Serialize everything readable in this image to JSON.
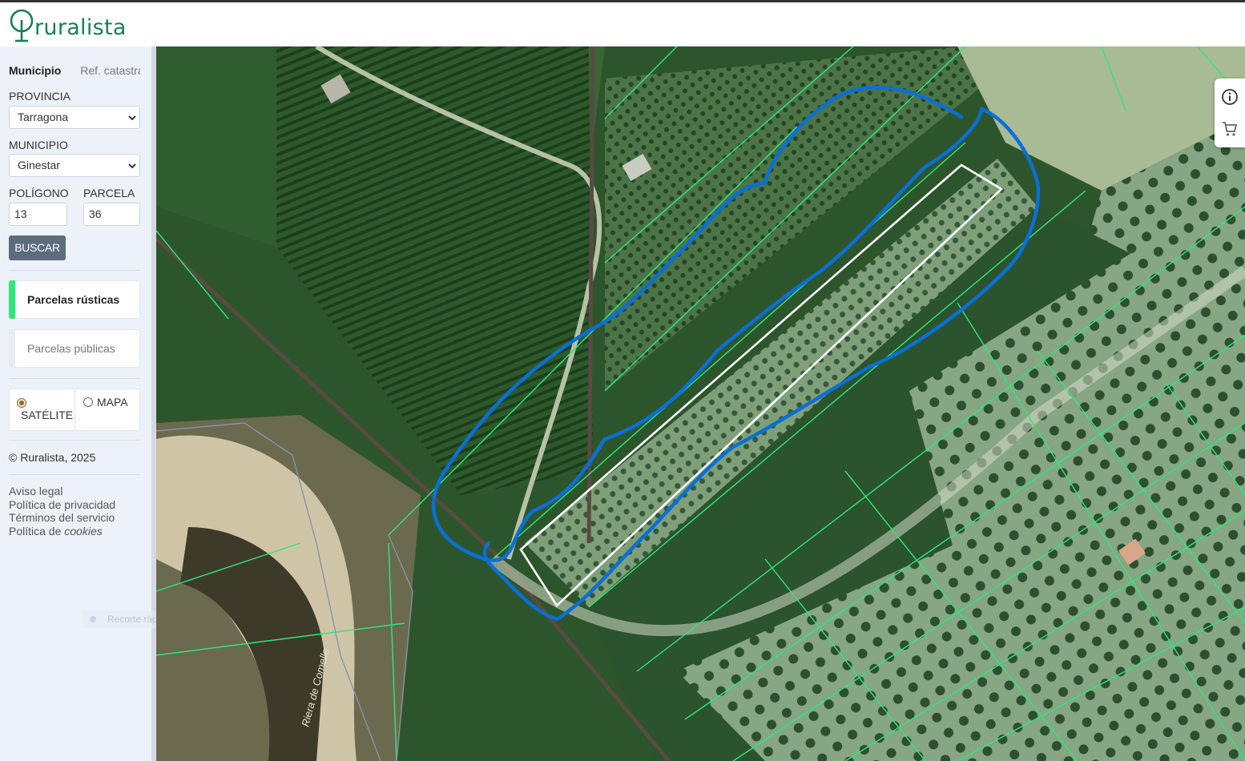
{
  "app": {
    "name": "ruralista",
    "brand_color": "#1a7f5a"
  },
  "sidebar": {
    "tabs": [
      {
        "label": "Municipio",
        "active": true
      },
      {
        "label": "Ref. catastral",
        "active": false
      }
    ],
    "provincia": {
      "label": "PROVINCIA",
      "value": "Tarragona"
    },
    "municipio": {
      "label": "MUNICIPIO",
      "value": "Ginestar"
    },
    "poligono": {
      "label": "POLÍGONO",
      "value": "13"
    },
    "parcela": {
      "label": "PARCELA",
      "value": "36"
    },
    "search_button": "BUSCAR",
    "layers": [
      {
        "label": "Parcelas rústicas",
        "active": true,
        "color": "#2ee87a"
      },
      {
        "label": "Parcelas públicas",
        "active": false,
        "color": "#e8ecf2"
      }
    ],
    "basemap": {
      "options": [
        {
          "label": "SATÉLITE",
          "selected": true
        },
        {
          "label": "MAPA",
          "selected": false
        }
      ]
    },
    "copyright": "© Ruralista, 2025",
    "footer": {
      "aviso": "Aviso legal",
      "privacidad": "Política de privacidad",
      "terminos": "Términos del servicio",
      "cookies_prefix": "Política de ",
      "cookies_em": "cookies"
    },
    "ghost_chip": "Recorte rápido"
  },
  "map": {
    "label_river": "Riera de Comelle",
    "parcel_line_color": "#2ee87a",
    "drawn_line_color": "#0a6fd6",
    "selected_parcel_color": "#ffffff",
    "tools": [
      {
        "name": "info-icon"
      },
      {
        "name": "cart-icon"
      }
    ]
  }
}
